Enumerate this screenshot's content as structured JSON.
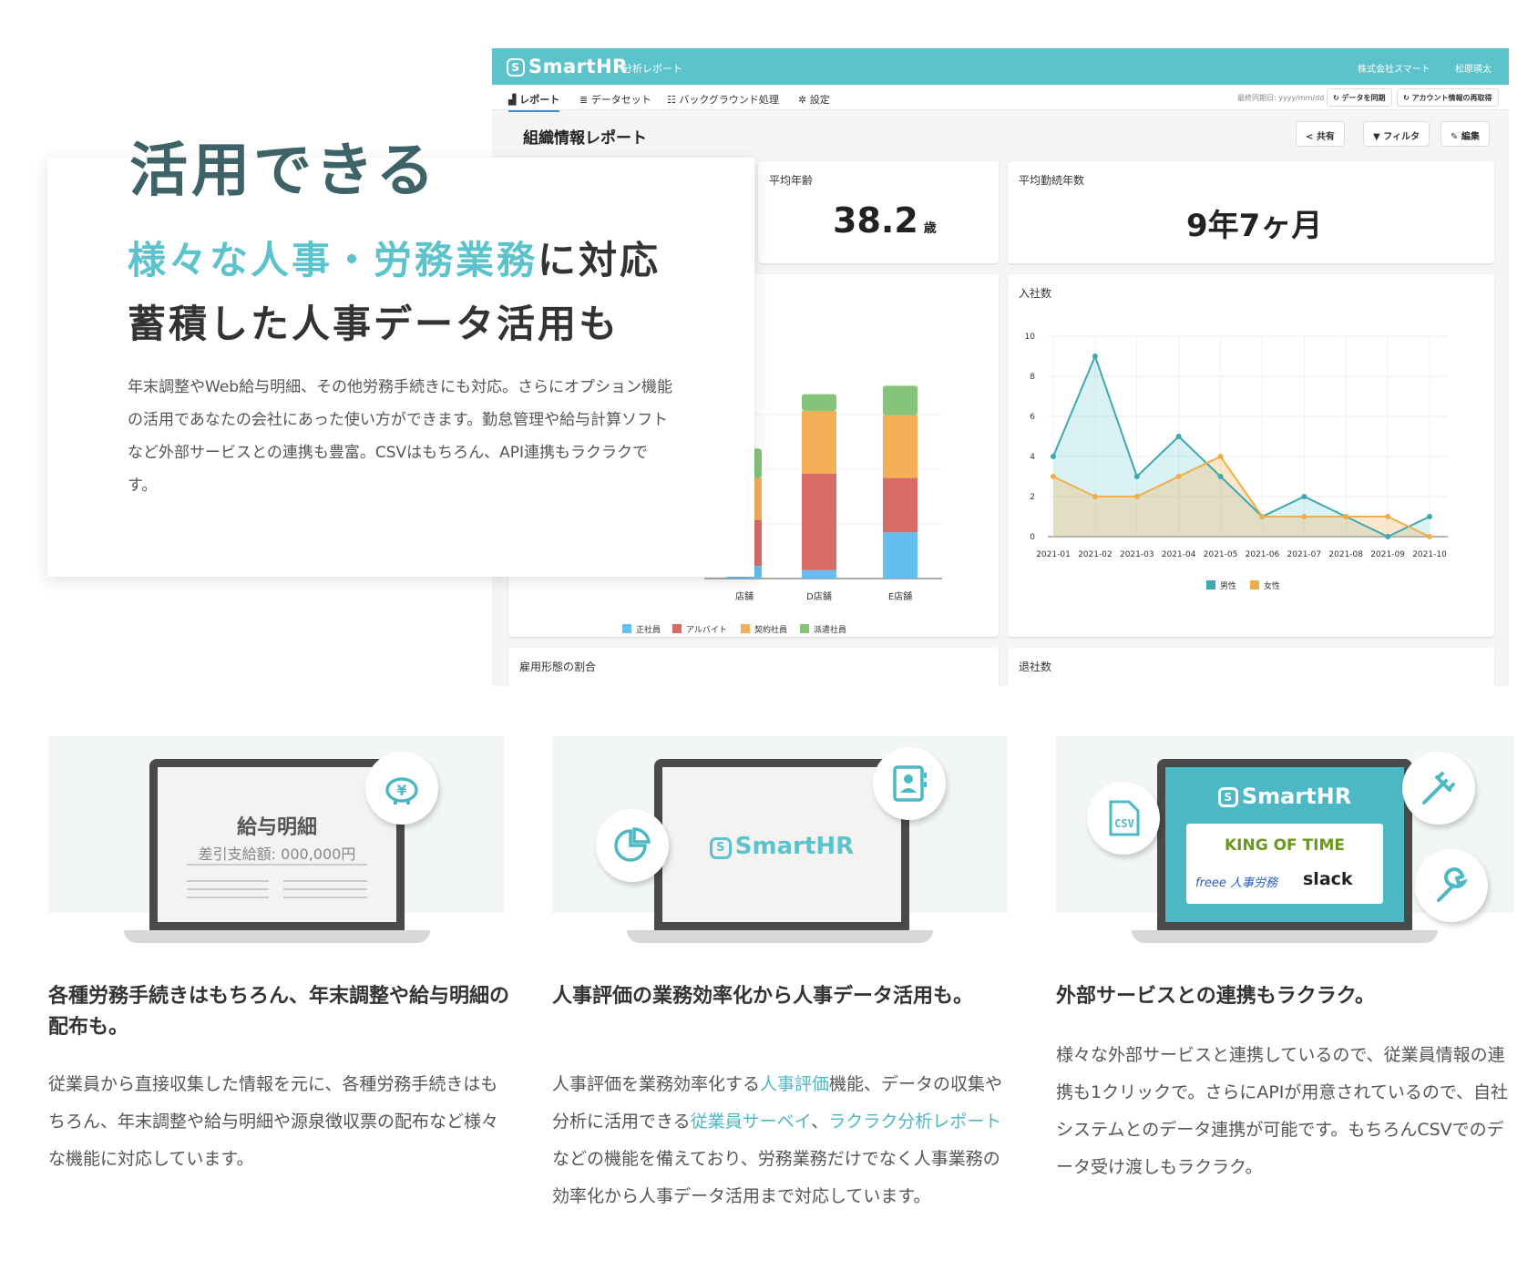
{
  "dashboard": {
    "logo": "SmartHR",
    "subtitle": "分析レポート",
    "company": "株式会社スマート",
    "user": "松原瑛太",
    "nav": [
      "レポート",
      "データセット",
      "バックグラウンド処理",
      "設定"
    ],
    "sync_date": "最終同期日: yyyy/mm/dd",
    "sync_button": "データを同期",
    "refetch_button": "アカウント情報の再取得",
    "report_title": "組織情報レポート",
    "share_button": "共有",
    "filter_button": "フィルタ",
    "edit_button": "編集",
    "avg_age_label": "平均年齢",
    "avg_age_value": "38.2",
    "avg_age_unit": "歳",
    "avg_tenure_label": "平均勤続年数",
    "avg_tenure_value": "9年7ヶ月",
    "employment_ratio_label": "雇用形態の割合",
    "leavers_label": "退社数"
  },
  "colors": {
    "accent": "#5bc3cb",
    "regular": "#64bff0",
    "parttime": "#d96b67",
    "contract": "#f3b056",
    "dispatch": "#86c47a",
    "male": "#3ea8b0",
    "female": "#f0ae4a"
  },
  "chart_data": [
    {
      "type": "bar",
      "stacked": true,
      "categories": [
        "店舗",
        "D店舗",
        "E店舗"
      ],
      "series": [
        {
          "name": "正社員",
          "values": [
            3,
            2,
            11
          ]
        },
        {
          "name": "アルバイト",
          "values": [
            11,
            23,
            13
          ]
        },
        {
          "name": "契約社員",
          "values": [
            10,
            15,
            15
          ]
        },
        {
          "name": "派遣社員",
          "values": [
            7,
            4,
            7
          ]
        }
      ],
      "legend": "bottom"
    },
    {
      "type": "area",
      "title": "入社数",
      "x": [
        "2021-01",
        "2021-02",
        "2021-03",
        "2021-04",
        "2021-05",
        "2021-06",
        "2021-07",
        "2021-08",
        "2021-09",
        "2021-10"
      ],
      "series": [
        {
          "name": "男性",
          "values": [
            4,
            9,
            3,
            5,
            3,
            1,
            2,
            1,
            0,
            1
          ]
        },
        {
          "name": "女性",
          "values": [
            3,
            2,
            2,
            3,
            4,
            1,
            1,
            1,
            1,
            0
          ]
        }
      ],
      "ylim": [
        0,
        10
      ],
      "yticks": [
        0,
        2,
        4,
        6,
        8,
        10
      ],
      "grid": true,
      "legend": "bottom"
    }
  ],
  "hero": {
    "title": "活用できる",
    "line1_highlight": "様々な人事・労務業務",
    "line1_rest": "に対応",
    "line2": "蓄積した人事データ活用も",
    "desc": "年末調整やWeb給与明細、その他労務手続きにも対応。さらにオプション機能の活用であなたの会社にあった使い方ができます。勤怠管理や給与計算ソフトなど外部サービスとの連携も豊富。CSVはもちろん、API連携もラクラクです。"
  },
  "features": [
    {
      "screen_title": "給与明細",
      "screen_sub": "差引支給額: 000,000円",
      "title": "各種労務手続きはもちろん、年末調整や給与明細の配布も。",
      "desc": "従業員から直接収集した情報を元に、各種労務手続きはもちろん、年末調整や給与明細や源泉徴収票の配布など様々な機能に対応しています。"
    },
    {
      "screen_logo": "SmartHR",
      "title": "人事評価の業務効率化から人事データ活用も。",
      "desc_parts": [
        "人事評価を業務効率化する",
        "人事評価",
        "機能、データの収集や分析に活用できる",
        "従業員サーベイ",
        "、",
        "ラクラク分析レポート",
        "などの機能を備えており、労務業務だけでなく人事業務の効率化から人事データ活用まで対応しています。"
      ]
    },
    {
      "screen_logo": "SmartHR",
      "partner1": "KING OF TIME",
      "partner2": "freee 人事労務",
      "partner3": "slack",
      "csv_label": "CSV",
      "title": "外部サービスとの連携もラクラク。",
      "desc": "様々な外部サービスと連携しているので、従業員情報の連携も1クリックで。さらにAPIが用意されているので、自社システムとのデータ連携が可能です。もちろんCSVでのデータ受け渡しもラクラク。"
    }
  ]
}
